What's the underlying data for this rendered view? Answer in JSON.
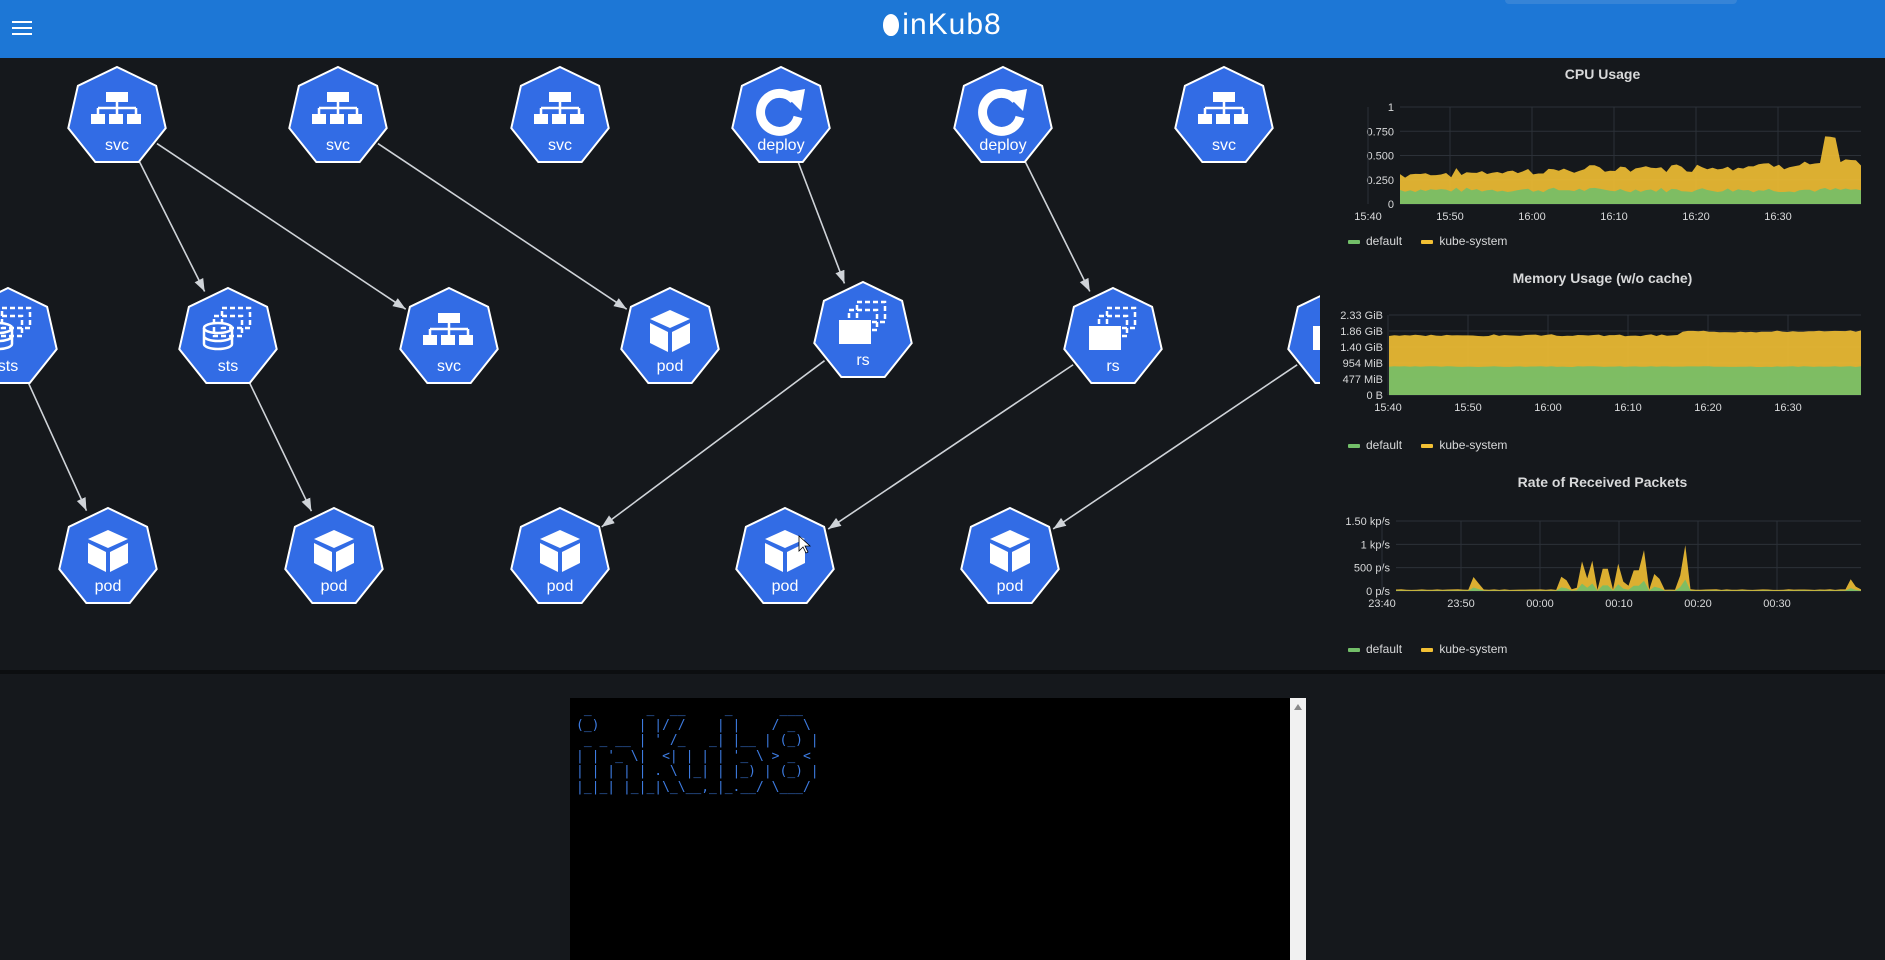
{
  "app": {
    "title": "inKub8"
  },
  "colors": {
    "accent": "#1d77d6",
    "node": "#326ce5",
    "default_series": "#73bf69",
    "kube_system_series": "#f2c034"
  },
  "graph": {
    "nodes": [
      {
        "id": "n1",
        "label": "svc",
        "icon": "service-icon"
      },
      {
        "id": "n2",
        "label": "svc",
        "icon": "service-icon"
      },
      {
        "id": "n3",
        "label": "svc",
        "icon": "service-icon"
      },
      {
        "id": "n4",
        "label": "deploy",
        "icon": "deploy-icon"
      },
      {
        "id": "n5",
        "label": "deploy",
        "icon": "deploy-icon"
      },
      {
        "id": "n6",
        "label": "svc",
        "icon": "service-icon"
      },
      {
        "id": "n7",
        "label": "sts",
        "icon": "statefulset-icon"
      },
      {
        "id": "n8",
        "label": "sts",
        "icon": "statefulset-icon"
      },
      {
        "id": "n9",
        "label": "svc",
        "icon": "service-icon"
      },
      {
        "id": "n10",
        "label": "pod",
        "icon": "pod-icon"
      },
      {
        "id": "n11",
        "label": "rs",
        "icon": "replicaset-icon"
      },
      {
        "id": "n12",
        "label": "rs",
        "icon": "replicaset-icon"
      },
      {
        "id": "n13",
        "label": "",
        "icon": "replicaset-icon"
      },
      {
        "id": "n14",
        "label": "pod",
        "icon": "pod-icon"
      },
      {
        "id": "n15",
        "label": "pod",
        "icon": "pod-icon"
      },
      {
        "id": "n16",
        "label": "pod",
        "icon": "pod-icon"
      },
      {
        "id": "n17",
        "label": "pod",
        "icon": "pod-icon"
      },
      {
        "id": "n18",
        "label": "pod",
        "icon": "pod-icon"
      }
    ],
    "edges": [
      [
        "n1",
        "n8"
      ],
      [
        "n1",
        "n9"
      ],
      [
        "n2",
        "n10"
      ],
      [
        "n4",
        "n11"
      ],
      [
        "n5",
        "n12"
      ],
      [
        "n7",
        "n14"
      ],
      [
        "n8",
        "n15"
      ],
      [
        "n11",
        "n16"
      ],
      [
        "n12",
        "n17"
      ],
      [
        "n13",
        "n18"
      ]
    ]
  },
  "panels": [
    {
      "title": "CPU Usage",
      "y_ticks": [
        "1",
        "0.750",
        "0.500",
        "0.250",
        "0"
      ],
      "x_ticks": [
        "15:40",
        "15:50",
        "16:00",
        "16:10",
        "16:20",
        "16:30"
      ],
      "legend": [
        "default",
        "kube-system"
      ]
    },
    {
      "title": "Memory Usage (w/o cache)",
      "y_ticks": [
        "2.33 GiB",
        "1.86 GiB",
        "1.40 GiB",
        "954 MiB",
        "477 MiB",
        "0 B"
      ],
      "x_ticks": [
        "15:40",
        "15:50",
        "16:00",
        "16:10",
        "16:20",
        "16:30"
      ],
      "legend": [
        "default",
        "kube-system"
      ]
    },
    {
      "title": "Rate of Received Packets",
      "y_ticks": [
        "1.50 kp/s",
        "1 kp/s",
        "500 p/s",
        "0 p/s"
      ],
      "x_ticks": [
        "23:40",
        "23:50",
        "00:00",
        "00:10",
        "00:20",
        "00:30"
      ],
      "legend": [
        "default",
        "kube-system"
      ]
    }
  ],
  "terminal": {
    "banner": " _       _  __     _      ___  \n(_)     | |/ /    | |    / _ \\ \n _ _ __ | ' /_   _| |__ | (_) |\n| | '_ \\|  <| | | | '_ \\ > _ < \n| | | | | . \\ |_| | |_) | (_) |\n|_|_| |_|_|\\_\\__,_|_.__/ \\___/ "
  }
}
